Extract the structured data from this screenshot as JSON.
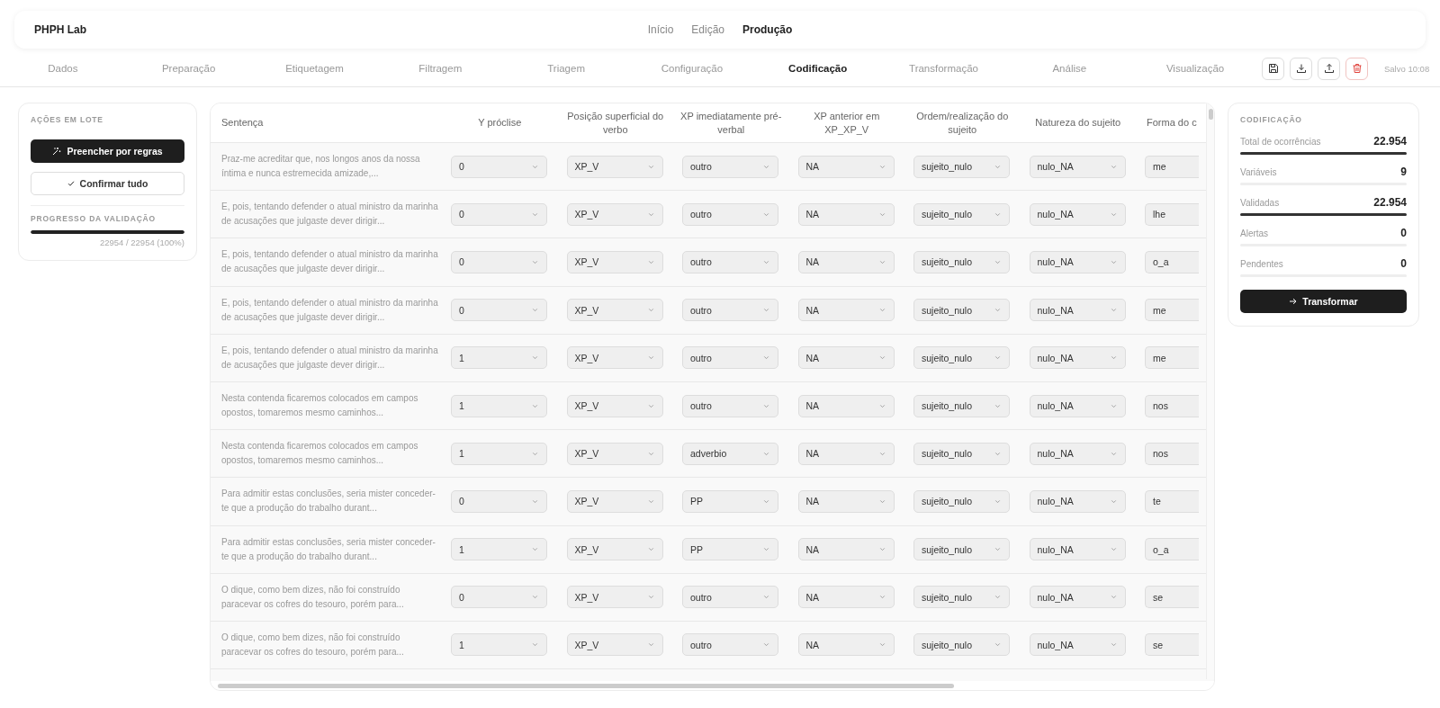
{
  "topbar": {
    "brand": "PHPH Lab",
    "nav": [
      {
        "label": "Início",
        "selected": false
      },
      {
        "label": "Edição",
        "selected": false
      },
      {
        "label": "Produção",
        "selected": true
      }
    ]
  },
  "steps": [
    {
      "label": "Dados",
      "selected": false
    },
    {
      "label": "Preparação",
      "selected": false
    },
    {
      "label": "Etiquetagem",
      "selected": false
    },
    {
      "label": "Filtragem",
      "selected": false
    },
    {
      "label": "Triagem",
      "selected": false
    },
    {
      "label": "Configuração",
      "selected": false
    },
    {
      "label": "Codificação",
      "selected": true
    },
    {
      "label": "Transformação",
      "selected": false
    },
    {
      "label": "Análise",
      "selected": false
    },
    {
      "label": "Visualização",
      "selected": false
    }
  ],
  "toolbar": {
    "actions": [
      {
        "kind": "save"
      },
      {
        "kind": "download"
      },
      {
        "kind": "upload"
      },
      {
        "kind": "delete"
      }
    ],
    "status": "Salvo 10:08"
  },
  "batch_panel": {
    "title": "AÇÕES EM LOTE",
    "primary_button": "Preencher por regras",
    "secondary_button": "Confirmar tudo",
    "progress": {
      "title": "PROGRESSO DA VALIDAÇÃO",
      "level": 1,
      "reading": "22954 / 22954 (100%)"
    }
  },
  "table": {
    "columns": [
      "Sentença",
      "Y próclise",
      "Posição superficial do verbo",
      "XP imediatamente pré-verbal",
      "XP anterior em XP_XP_V",
      "Ordem/realização do sujeito",
      "Natureza do sujeito",
      "Forma do c"
    ],
    "rows": [
      {
        "sentence": "Praz-me acreditar que, nos longos anos da nossa íntima e nunca estremecida amizade,...",
        "values": [
          "0",
          "XP_V",
          "outro",
          "NA",
          "sujeito_nulo",
          "nulo_NA",
          "me"
        ]
      },
      {
        "sentence": "E, pois, tentando defender o atual ministro da marinha de acusações que julgaste dever dirigir...",
        "values": [
          "0",
          "XP_V",
          "outro",
          "NA",
          "sujeito_nulo",
          "nulo_NA",
          "lhe"
        ]
      },
      {
        "sentence": "E, pois, tentando defender o atual ministro da marinha de acusações que julgaste dever dirigir...",
        "values": [
          "0",
          "XP_V",
          "outro",
          "NA",
          "sujeito_nulo",
          "nulo_NA",
          "o_a"
        ]
      },
      {
        "sentence": "E, pois, tentando defender o atual ministro da marinha de acusações que julgaste dever dirigir...",
        "values": [
          "0",
          "XP_V",
          "outro",
          "NA",
          "sujeito_nulo",
          "nulo_NA",
          "me"
        ]
      },
      {
        "sentence": "E, pois, tentando defender o atual ministro da marinha de acusações que julgaste dever dirigir...",
        "values": [
          "1",
          "XP_V",
          "outro",
          "NA",
          "sujeito_nulo",
          "nulo_NA",
          "me"
        ]
      },
      {
        "sentence": "Nesta contenda ficaremos colocados em campos opostos, tomaremos mesmo caminhos...",
        "values": [
          "1",
          "XP_V",
          "outro",
          "NA",
          "sujeito_nulo",
          "nulo_NA",
          "nos"
        ]
      },
      {
        "sentence": "Nesta contenda ficaremos colocados em campos opostos, tomaremos mesmo caminhos...",
        "values": [
          "1",
          "XP_V",
          "adverbio",
          "NA",
          "sujeito_nulo",
          "nulo_NA",
          "nos"
        ]
      },
      {
        "sentence": "Para admitir estas conclusões, seria mister conceder-te que a produção do trabalho durant...",
        "values": [
          "0",
          "XP_V",
          "PP",
          "NA",
          "sujeito_nulo",
          "nulo_NA",
          "te"
        ]
      },
      {
        "sentence": "Para admitir estas conclusões, seria mister conceder-te que a produção do trabalho durant...",
        "values": [
          "1",
          "XP_V",
          "PP",
          "NA",
          "sujeito_nulo",
          "nulo_NA",
          "o_a"
        ]
      },
      {
        "sentence": "O dique, como bem dizes, não foi construído paracevar os cofres do tesouro, porém para...",
        "values": [
          "0",
          "XP_V",
          "outro",
          "NA",
          "sujeito_nulo",
          "nulo_NA",
          "se"
        ]
      },
      {
        "sentence": "O dique, como bem dizes, não foi construído paracevar os cofres do tesouro, porém para...",
        "values": [
          "1",
          "XP_V",
          "outro",
          "NA",
          "sujeito_nulo",
          "nulo_NA",
          "se"
        ]
      }
    ]
  },
  "summary": {
    "title": "CODIFICAÇÃO",
    "stats": [
      {
        "label": "Total de ocorrências",
        "value": "22.954",
        "level": 1
      },
      {
        "label": "Variáveis",
        "value": "9",
        "level": 0
      },
      {
        "label": "Validadas",
        "value": "22.954",
        "level": 1
      },
      {
        "label": "Alertas",
        "value": "0",
        "level": 0
      },
      {
        "label": "Pendentes",
        "value": "0",
        "level": 0
      }
    ],
    "button": "Transformar"
  }
}
